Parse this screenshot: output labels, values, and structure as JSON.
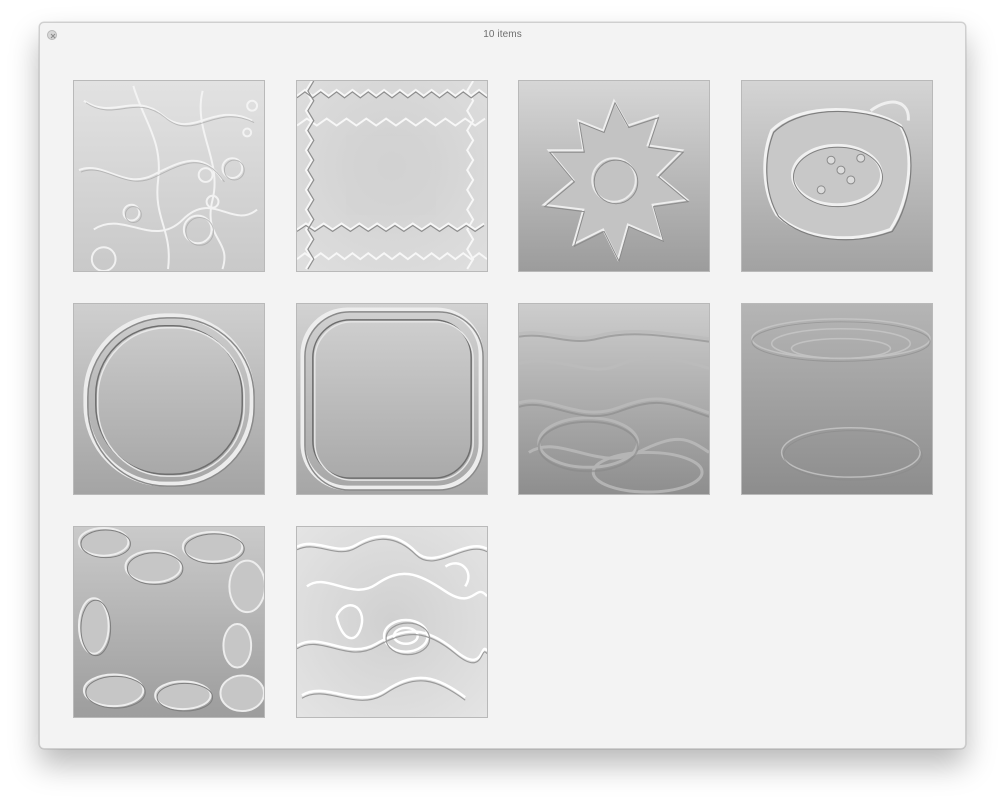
{
  "window": {
    "title": "10 items"
  },
  "items": [
    {
      "icon": "organic-embossed-texture-thumbnail"
    },
    {
      "icon": "zigzag-embossed-texture-thumbnail"
    },
    {
      "icon": "splat-embossed-texture-thumbnail"
    },
    {
      "icon": "ring-splat-embossed-texture-thumbnail"
    },
    {
      "icon": "circle-frame-embossed-thumbnail"
    },
    {
      "icon": "rounded-square-frame-embossed-thumbnail"
    },
    {
      "icon": "water-ripple-texture-thumbnail"
    },
    {
      "icon": "soft-ripple-texture-thumbnail"
    },
    {
      "icon": "bubbles-edge-embossed-thumbnail"
    },
    {
      "icon": "liquid-shine-texture-thumbnail"
    }
  ]
}
